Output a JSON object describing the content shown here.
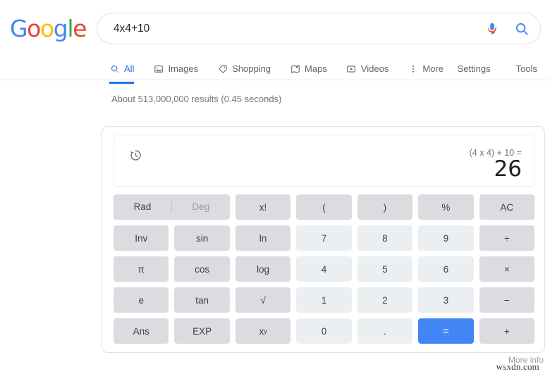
{
  "brand": {
    "logo_letters": [
      "G",
      "o",
      "o",
      "g",
      "l",
      "e"
    ],
    "colors": {
      "blue": "#4285F4",
      "red": "#EA4335",
      "yellow": "#FBBC05",
      "green": "#34A853",
      "accent": "#1a73e8",
      "equals_blue": "#4285f4"
    }
  },
  "search": {
    "query": "4x4+10",
    "placeholder": "Search",
    "mic_icon": "microphone-icon",
    "search_icon": "search-icon"
  },
  "nav": {
    "tabs": [
      {
        "label": "All",
        "icon": "search-icon",
        "active": true
      },
      {
        "label": "Images",
        "icon": "image-icon",
        "active": false
      },
      {
        "label": "Shopping",
        "icon": "tag-icon",
        "active": false
      },
      {
        "label": "Maps",
        "icon": "map-icon",
        "active": false
      },
      {
        "label": "Videos",
        "icon": "video-play-icon",
        "active": false
      },
      {
        "label": "More",
        "icon": "more-vertical-icon",
        "active": false
      }
    ],
    "right_links": [
      {
        "label": "Settings"
      },
      {
        "label": "Tools"
      }
    ]
  },
  "results": {
    "stats": "About 513,000,000 results (0.45 seconds)"
  },
  "calculator": {
    "history_icon": "history-clock-icon",
    "expression": "(4 x 4) + 10 =",
    "result": "26",
    "mode": {
      "rad_label": "Rad",
      "deg_label": "Deg",
      "active": "Rad"
    },
    "keys": [
      {
        "label": "x!",
        "type": "func",
        "name": "factorial"
      },
      {
        "label": "(",
        "type": "func",
        "name": "open-paren"
      },
      {
        "label": ")",
        "type": "func",
        "name": "close-paren"
      },
      {
        "label": "%",
        "type": "func",
        "name": "percent"
      },
      {
        "label": "AC",
        "type": "func",
        "name": "all-clear"
      },
      {
        "label": "Inv",
        "type": "func",
        "name": "inverse"
      },
      {
        "label": "sin",
        "type": "func",
        "name": "sin"
      },
      {
        "label": "ln",
        "type": "func",
        "name": "ln"
      },
      {
        "label": "7",
        "type": "num",
        "name": "digit-7"
      },
      {
        "label": "8",
        "type": "num",
        "name": "digit-8"
      },
      {
        "label": "9",
        "type": "num",
        "name": "digit-9"
      },
      {
        "label": "÷",
        "type": "func",
        "name": "divide"
      },
      {
        "label": "π",
        "type": "func",
        "name": "pi"
      },
      {
        "label": "cos",
        "type": "func",
        "name": "cos"
      },
      {
        "label": "log",
        "type": "func",
        "name": "log"
      },
      {
        "label": "4",
        "type": "num",
        "name": "digit-4"
      },
      {
        "label": "5",
        "type": "num",
        "name": "digit-5"
      },
      {
        "label": "6",
        "type": "num",
        "name": "digit-6"
      },
      {
        "label": "×",
        "type": "func",
        "name": "multiply"
      },
      {
        "label": "e",
        "type": "func",
        "name": "euler"
      },
      {
        "label": "tan",
        "type": "func",
        "name": "tan"
      },
      {
        "label": "√",
        "type": "func",
        "name": "square-root"
      },
      {
        "label": "1",
        "type": "num",
        "name": "digit-1"
      },
      {
        "label": "2",
        "type": "num",
        "name": "digit-2"
      },
      {
        "label": "3",
        "type": "num",
        "name": "digit-3"
      },
      {
        "label": "−",
        "type": "func",
        "name": "minus"
      },
      {
        "label": "Ans",
        "type": "func",
        "name": "answer"
      },
      {
        "label": "EXP",
        "type": "func",
        "name": "exponent"
      },
      {
        "label": "x^y",
        "type": "func",
        "name": "power"
      },
      {
        "label": "0",
        "type": "num",
        "name": "digit-0"
      },
      {
        "label": ".",
        "type": "num",
        "name": "decimal-point"
      },
      {
        "label": "=",
        "type": "equals",
        "name": "equals"
      },
      {
        "label": "+",
        "type": "func",
        "name": "plus"
      }
    ]
  },
  "footer": {
    "more_info": "More info",
    "watermark": "wsxdn.com"
  }
}
